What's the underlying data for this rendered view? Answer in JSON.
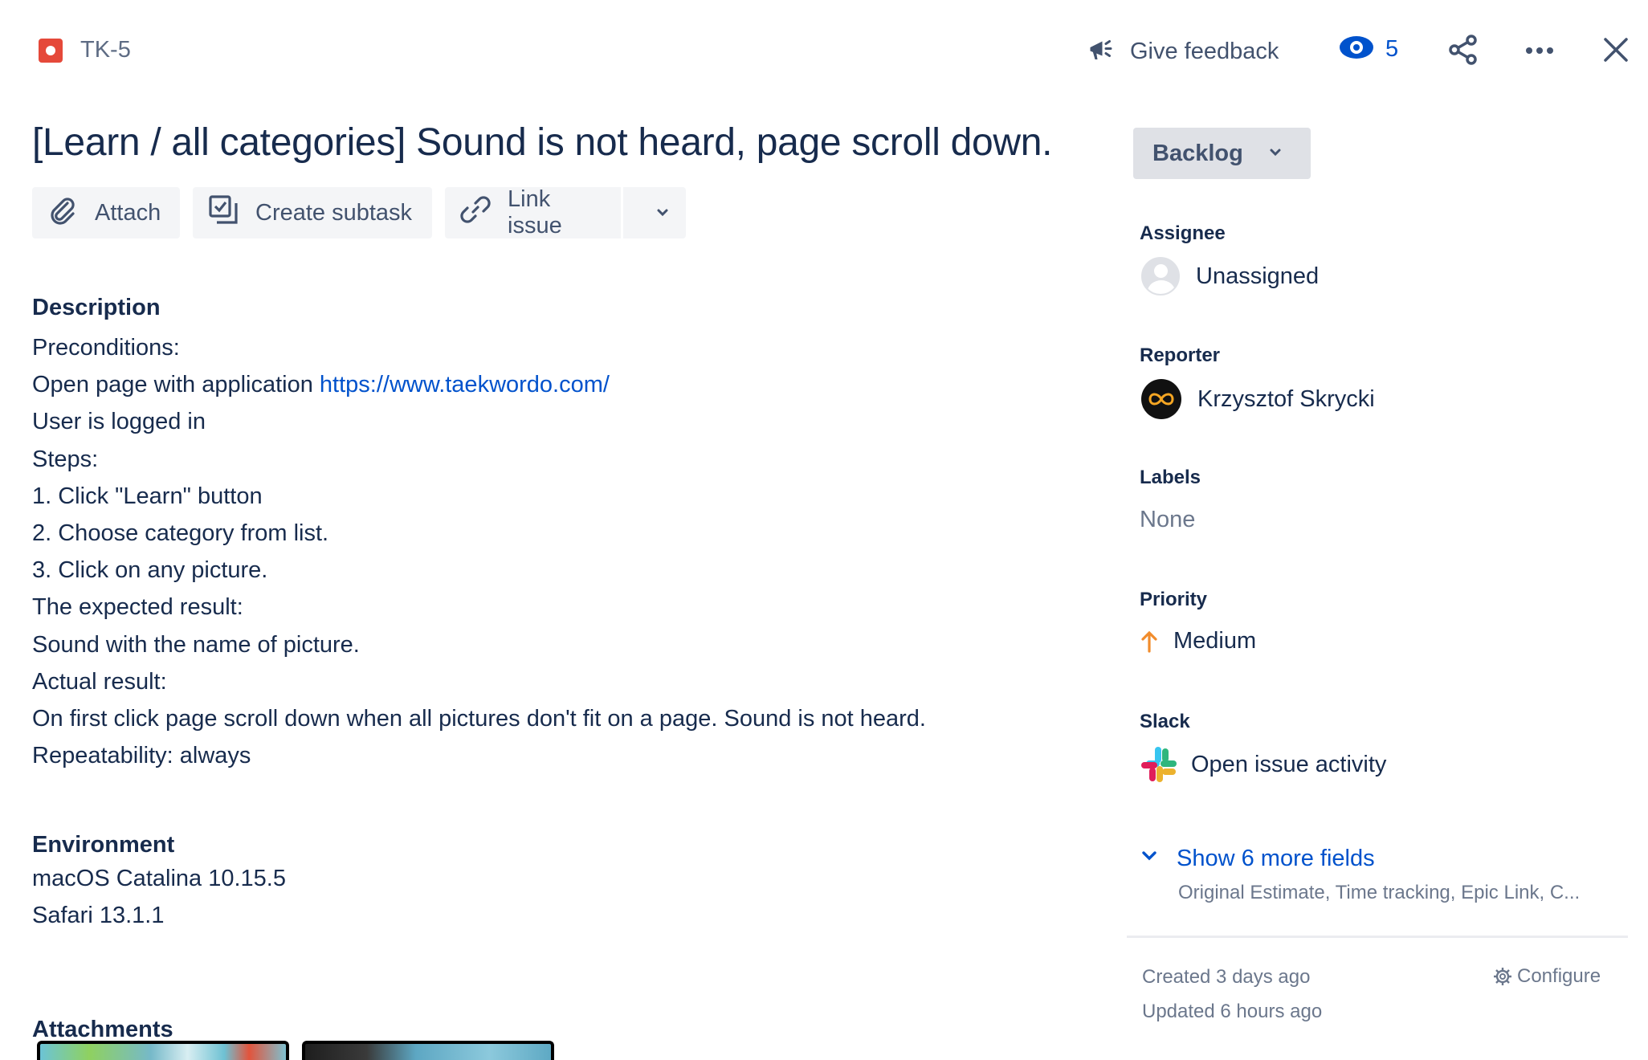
{
  "header": {
    "issue_key": "TK-5",
    "feedback_label": "Give feedback",
    "watchers_count": "5"
  },
  "issue": {
    "title": "[Learn / all categories] Sound is not heard, page scroll down."
  },
  "toolbar": {
    "attach_label": "Attach",
    "subtask_label": "Create subtask",
    "link_label": "Link issue"
  },
  "description": {
    "heading": "Description",
    "preconditions": "Preconditions:",
    "open_page_prefix": "Open page with application ",
    "url": "https://www.taekwordo.com/",
    "logged_in": "User is logged in",
    "steps": "Steps:",
    "step1": "1. Click \"Learn\" button",
    "step2": "2. Choose category from list.",
    "step3": "3. Click on any picture.",
    "expected_heading": "The expected result:",
    "expected": "Sound with the name of picture.",
    "actual_heading": "Actual result:",
    "actual": "On first click page scroll down when all pictures don't fit on a page. Sound is not heard.",
    "repeatability": "Repeatability: always"
  },
  "environment": {
    "heading": "Environment",
    "os": "macOS Catalina 10.15.5",
    "browser": "Safari 13.1.1"
  },
  "attachments": {
    "heading": "Attachments"
  },
  "sidebar": {
    "status": "Backlog",
    "assignee_label": "Assignee",
    "assignee_value": "Unassigned",
    "reporter_label": "Reporter",
    "reporter_value": "Krzysztof Skrycki",
    "labels_label": "Labels",
    "labels_value": "None",
    "priority_label": "Priority",
    "priority_value": "Medium",
    "slack_label": "Slack",
    "slack_value": "Open issue activity",
    "show_more": "Show 6 more fields",
    "show_more_sub": "Original Estimate, Time tracking, Epic Link, C...",
    "created": "Created 3 days ago",
    "updated": "Updated 6 hours ago",
    "configure": "Configure"
  },
  "colors": {
    "accent": "#0052cc",
    "bug": "#e5493a",
    "priority_medium": "#f18c2c"
  }
}
